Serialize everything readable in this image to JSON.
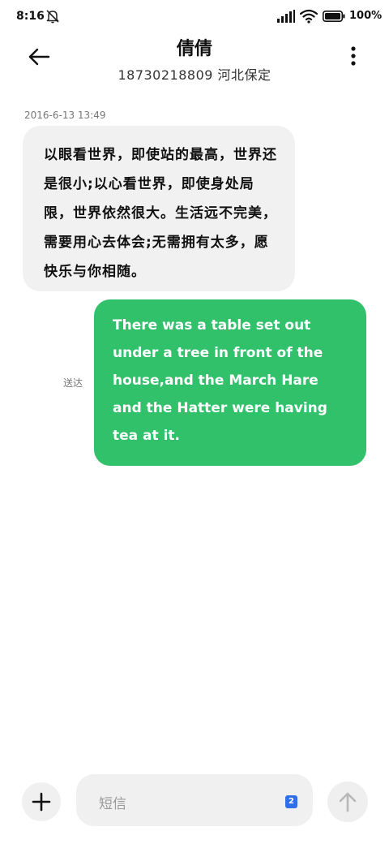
{
  "status_bar": {
    "time": "8:16",
    "battery_text": "100%",
    "icons": [
      "bell-off-icon",
      "signal-icon",
      "wifi-icon",
      "battery-icon"
    ]
  },
  "header": {
    "back_icon": "arrow-left-icon",
    "contact_name": "倩倩",
    "contact_subtitle": "18730218809 河北保定",
    "menu_icon": "more-vertical-icon"
  },
  "conversation": {
    "timestamp": "2016-6-13 13:49",
    "messages": [
      {
        "direction": "incoming",
        "text": "以眼看世界，即使站的最高，世界还是很小;以心看世界，即使身处局限，世界依然很大。生活远不完美，需要用心去体会;无需拥有太多，愿快乐与你相随。"
      },
      {
        "direction": "outgoing",
        "text": "There was a table set out under a tree in front of the house,and the March Hare and the Hatter were having tea at it.",
        "status": "送达"
      }
    ]
  },
  "input_bar": {
    "add_icon": "plus-icon",
    "placeholder": "短信",
    "sim_badge": "2",
    "send_icon": "arrow-up-icon"
  },
  "colors": {
    "outgoing_bubble": "#31c16b",
    "incoming_bubble": "#f1f1f1",
    "sim_badge": "#2f6fe8",
    "background": "#ffffff"
  }
}
